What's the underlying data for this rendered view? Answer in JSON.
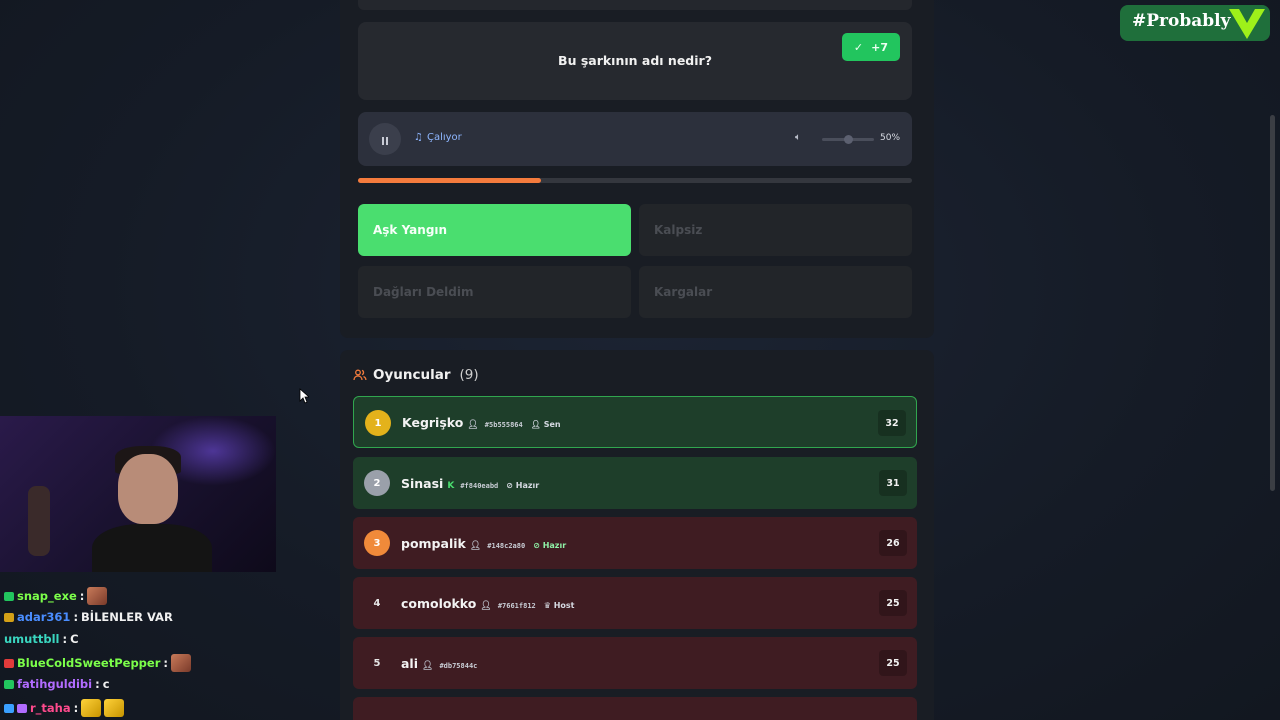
{
  "quiz": {
    "question": "Bu şarkının adı nedir?",
    "score_badge": "+7"
  },
  "audio": {
    "status": "Çalıyor",
    "volume_label": "50%",
    "volume_level": 0.5,
    "progress": 0.33
  },
  "answers": [
    {
      "label": "Aşk Yangın",
      "state": "correct"
    },
    {
      "label": "Kalpsiz",
      "state": "disabled"
    },
    {
      "label": "Dağları Deldim",
      "state": "disabled"
    },
    {
      "label": "Kargalar",
      "state": "disabled"
    }
  ],
  "players": {
    "title": "Oyuncular",
    "count": "(9)",
    "list": [
      {
        "rank": "1",
        "name": "Kegrişko",
        "tag": "#5b555864",
        "status": "Sen",
        "score": "32"
      },
      {
        "rank": "2",
        "name": "Sinasi",
        "tag": "#f840eabd",
        "status": "Hazır",
        "score": "31"
      },
      {
        "rank": "3",
        "name": "pompalik",
        "tag": "#148c2a80",
        "status": "Hazır",
        "score": "26"
      },
      {
        "rank": "4",
        "name": "comolokko",
        "tag": "#7661f812",
        "status": "Host",
        "score": "25"
      },
      {
        "rank": "5",
        "name": "ali",
        "tag": "#db75844c",
        "status": "",
        "score": "25"
      }
    ]
  },
  "overlay": {
    "brand": "#Probably",
    "brand_color": "#1f6f3b"
  },
  "chat": [
    {
      "user": "snap_exe",
      "sep": ":",
      "msg": "",
      "user_color": "#7cff4a"
    },
    {
      "user": "adar361",
      "sep": ":",
      "msg": "BİLENLER VAR",
      "user_color": "#4a8dff"
    },
    {
      "user": "umuttbll",
      "sep": ":",
      "msg": "C",
      "user_color": "#3ad6c0"
    },
    {
      "user": "BlueColdSweetPepper",
      "sep": ":",
      "msg": "",
      "user_color": "#7cff4a"
    },
    {
      "user": "fatihguldibi",
      "sep": ":",
      "msg": "c",
      "user_color": "#b16cff"
    },
    {
      "user": "r_taha",
      "sep": ":",
      "msg": "",
      "user_color": "#ff4a8d"
    }
  ]
}
